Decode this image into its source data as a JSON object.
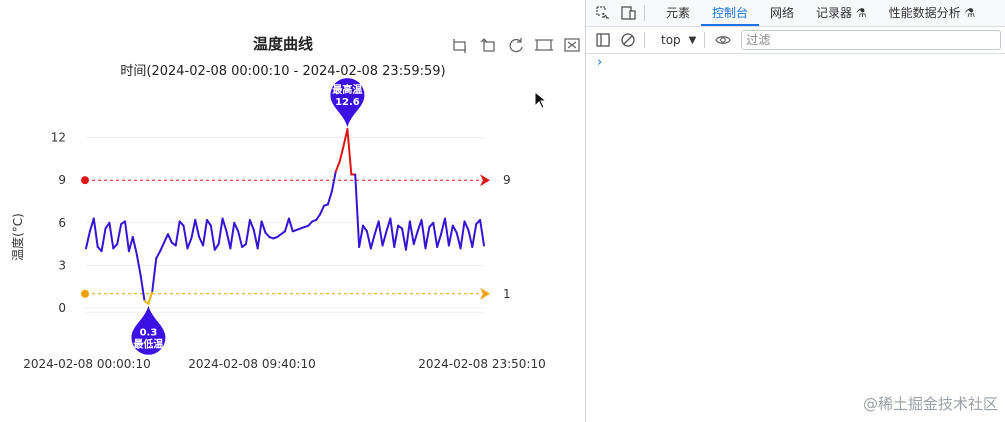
{
  "chart_data": {
    "type": "line",
    "title": "温度曲线",
    "subtitle": "时间(2024-02-08 00:00:10 - 2024-02-08 23:59:59)",
    "ylabel": "温度(°C)",
    "ylim": [
      -2,
      14
    ],
    "yticks": [
      "0",
      "3",
      "6",
      "9",
      "12"
    ],
    "x_ticks": [
      "2024-02-08 00:00:10",
      "2024-02-08 09:40:10",
      "2024-02-08 23:50:10"
    ],
    "series": [
      {
        "values": [
          4.2,
          5.4,
          6.3,
          4.3,
          4.0,
          5.6,
          6.0,
          4.2,
          4.5,
          5.9,
          6.1,
          4.0,
          5.0,
          3.8,
          2.3,
          0.5,
          0.3,
          1.2,
          3.5,
          4.0,
          4.6,
          5.2,
          4.6,
          4.4,
          6.1,
          5.8,
          4.2,
          4.9,
          6.2,
          5.0,
          4.4,
          6.2,
          5.8,
          4.1,
          4.5,
          6.3,
          5.4,
          4.2,
          6.0,
          5.4,
          4.3,
          4.5,
          6.2,
          5.5,
          4.2,
          6.1,
          5.3,
          5.0,
          4.9,
          5.0,
          5.2,
          5.4,
          6.3,
          5.4,
          5.5,
          5.6,
          5.7,
          5.8,
          6.1,
          6.2,
          6.6,
          7.2,
          7.3,
          8.2,
          9.6,
          10.3,
          11.4,
          12.6,
          9.4,
          9.4,
          4.3,
          5.8,
          5.4,
          4.2,
          5.2,
          6.1,
          4.4,
          5.4,
          6.3,
          4.3,
          5.8,
          5.6,
          4.1,
          6.1,
          4.5,
          5.4,
          6.2,
          4.2,
          5.7,
          6.0,
          4.3,
          5.2,
          6.3,
          4.4,
          5.8,
          5.3,
          4.2,
          6.1,
          5.5,
          4.3,
          5.9,
          6.2,
          4.4
        ]
      }
    ],
    "markers": {
      "max": {
        "label": "最高温",
        "value": "12.6"
      },
      "min": {
        "label": "最低温",
        "value": "0.3"
      }
    },
    "mark_lines": [
      {
        "value": 9,
        "label": "9",
        "color": "#e01414"
      },
      {
        "value": 1,
        "label": "1",
        "color": "#f0a100"
      }
    ],
    "line_color": "#3414d6",
    "peak_color": "#e01414",
    "low_color": "#e8b400",
    "marker_color": "#3a10e6"
  },
  "toolbox": [
    "zoom-icon",
    "zoom-reset-icon",
    "restore-icon",
    "data-view-icon",
    "fullscreen-icon"
  ],
  "devtools": {
    "tabs": [
      "元素",
      "控制台",
      "网络",
      "记录器",
      "性能数据分析"
    ],
    "active_tab": "控制台",
    "context": "top",
    "filter_placeholder": "过滤",
    "accent": "#1a73e8"
  },
  "watermark": "@稀土掘金技术社区"
}
